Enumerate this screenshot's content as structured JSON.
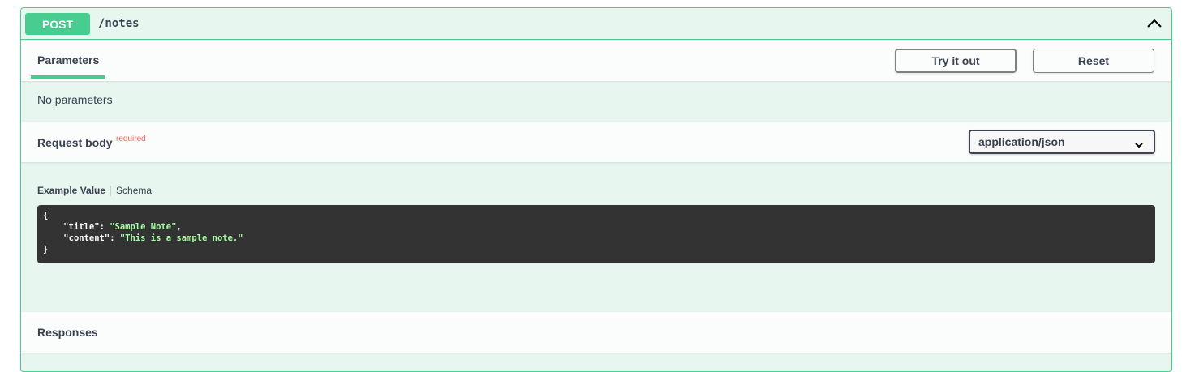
{
  "summary": {
    "method": "POST",
    "path": "/notes"
  },
  "parameters": {
    "tab_label": "Parameters",
    "try_button": "Try it out",
    "reset_button": "Reset",
    "empty_text": "No parameters"
  },
  "request_body": {
    "label": "Request body",
    "required": "required",
    "content_type": "application/json"
  },
  "example": {
    "tab_example": "Example Value",
    "tab_schema": "Schema",
    "lines": {
      "open": "{",
      "title_key": "\"title\"",
      "title_value": "\"Sample Note\"",
      "content_key": "\"content\"",
      "content_value": "\"This is a sample note.\"",
      "close": "}"
    }
  },
  "responses": {
    "label": "Responses"
  },
  "colors": {
    "post_accent": "#49cc90",
    "block_bg": "#e8f6f0",
    "code_bg": "#333333",
    "string_color": "#a2fca2",
    "required_color": "#ff6060"
  },
  "icons": {
    "collapse": "chevron-up-icon",
    "select": "chevron-down-icon"
  }
}
